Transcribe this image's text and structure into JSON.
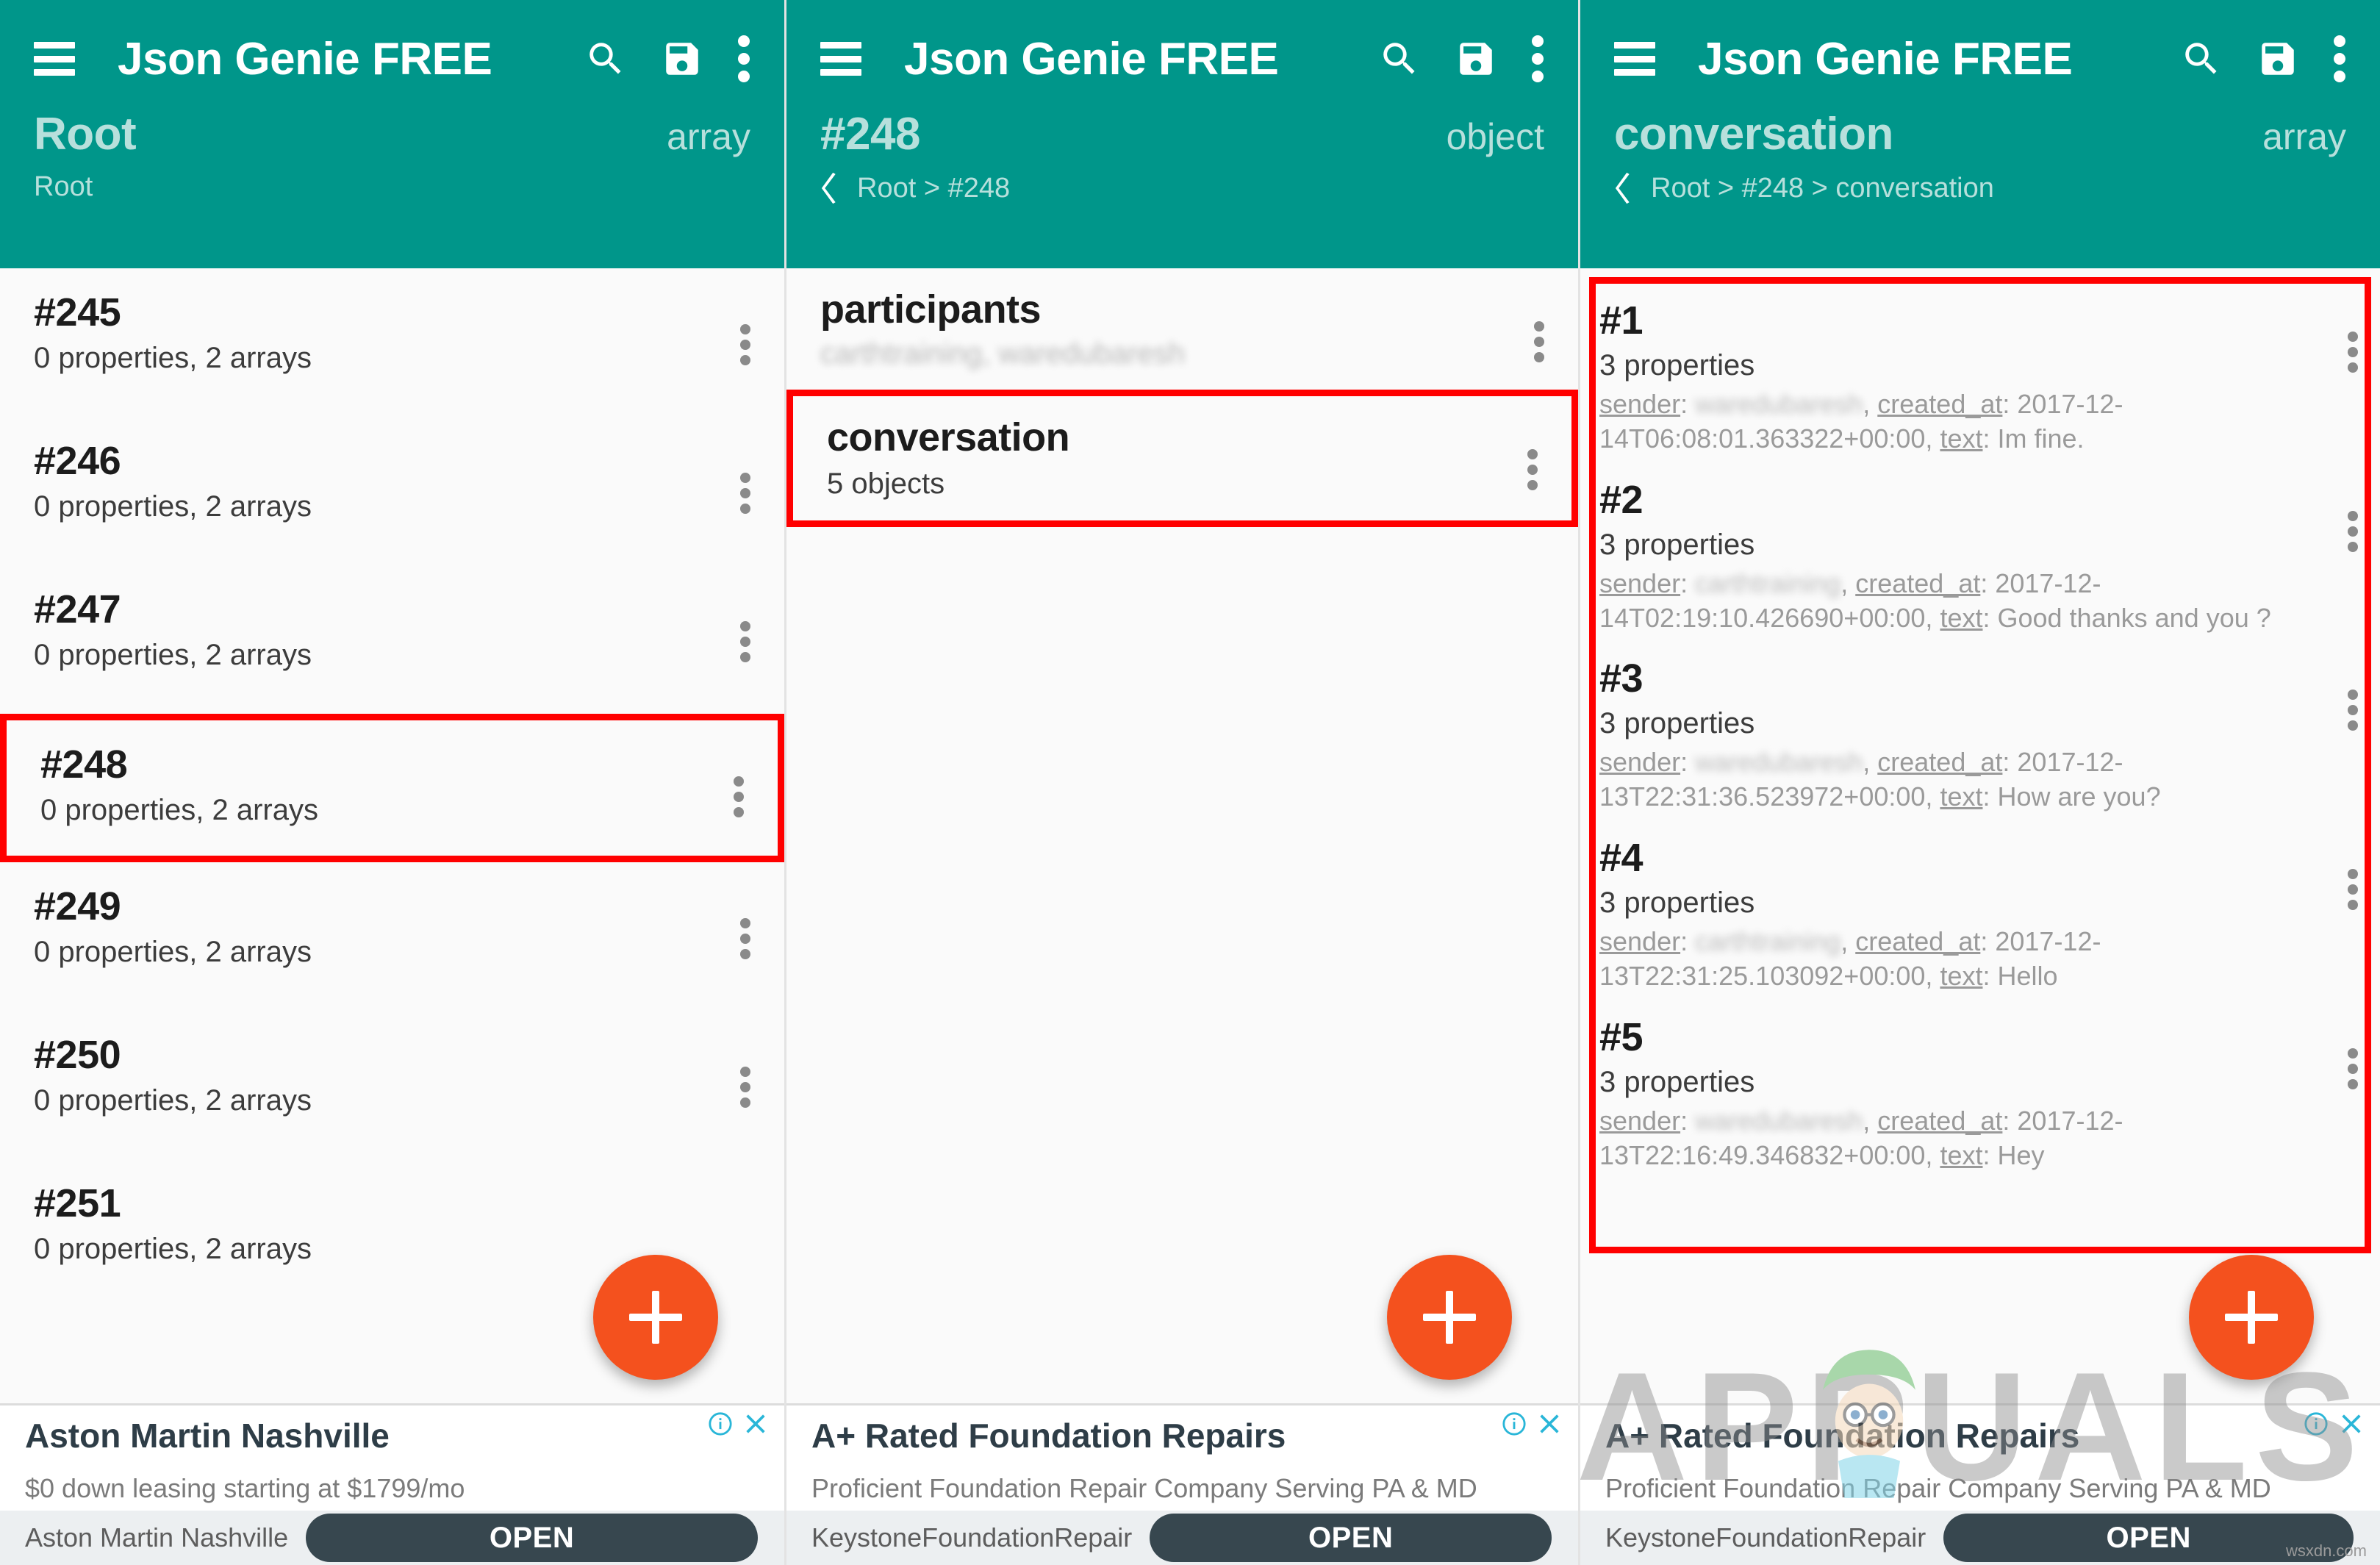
{
  "app": {
    "title": "Json Genie FREE",
    "theme_color": "#00968a",
    "fab_color": "#f4511e",
    "highlight_color": "#ff0000",
    "icons": {
      "menu": "hamburger-menu-icon",
      "search": "search-icon",
      "save": "save-icon",
      "overflow": "kebab-menu-icon",
      "back": "back-chevron-icon",
      "add": "add-plus-icon"
    }
  },
  "panels": [
    {
      "id": "root-panel",
      "header": {
        "node_name": "Root",
        "node_type": "array",
        "breadcrumb": "Root",
        "has_back": false
      },
      "rows": [
        {
          "title": "#245",
          "sub": "0 properties, 2 arrays",
          "highlighted": false
        },
        {
          "title": "#246",
          "sub": "0 properties, 2 arrays",
          "highlighted": false
        },
        {
          "title": "#247",
          "sub": "0 properties, 2 arrays",
          "highlighted": false
        },
        {
          "title": "#248",
          "sub": "0 properties, 2 arrays",
          "highlighted": true
        },
        {
          "title": "#249",
          "sub": "0 properties, 2 arrays",
          "highlighted": false
        },
        {
          "title": "#250",
          "sub": "0 properties, 2 arrays",
          "highlighted": false
        },
        {
          "title": "#251",
          "sub": "0 properties, 2 arrays",
          "highlighted": false
        }
      ],
      "ad": {
        "headline": "Aston Martin Nashville",
        "description": "$0 down leasing starting at $1799/mo",
        "advertiser": "Aston Martin Nashville",
        "cta": "OPEN"
      }
    },
    {
      "id": "node-248-panel",
      "header": {
        "node_name": "#248",
        "node_type": "object",
        "breadcrumb": "Root > #248",
        "has_back": true
      },
      "rows": [
        {
          "title": "participants",
          "sub": "",
          "sub_blurred": "carthtraining, waredubaresh",
          "highlighted": false
        },
        {
          "title": "conversation",
          "sub": "5 objects",
          "highlighted": true
        }
      ],
      "ad": {
        "headline": "A+ Rated Foundation Repairs",
        "description": "Proficient Foundation Repair Company Serving PA & MD",
        "advertiser": "KeystoneFoundationRepair",
        "cta": "OPEN"
      }
    },
    {
      "id": "conversation-panel",
      "header": {
        "node_name": "conversation",
        "node_type": "array",
        "breadcrumb": "Root > #248 > conversation",
        "has_back": true
      },
      "messages": [
        {
          "index": "#1",
          "properties": "3 properties",
          "sender_label": "sender",
          "sender_value": "waredubaresh",
          "created_label": "created_at",
          "created_value": "2017-12-14T06:08:01.363322+00:00",
          "text_label": "text",
          "text_value": "Im fine."
        },
        {
          "index": "#2",
          "properties": "3 properties",
          "sender_label": "sender",
          "sender_value": "carthtraining",
          "created_label": "created_at",
          "created_value": "2017-12-14T02:19:10.426690+00:00",
          "text_label": "text",
          "text_value": "Good thanks and you ?"
        },
        {
          "index": "#3",
          "properties": "3 properties",
          "sender_label": "sender",
          "sender_value": "waredubaresh",
          "created_label": "created_at",
          "created_value": "2017-12-13T22:31:36.523972+00:00",
          "text_label": "text",
          "text_value": "How are you?"
        },
        {
          "index": "#4",
          "properties": "3 properties",
          "sender_label": "sender",
          "sender_value": "carthtraining",
          "created_label": "created_at",
          "created_value": "2017-12-13T22:31:25.103092+00:00",
          "text_label": "text",
          "text_value": "Hello"
        },
        {
          "index": "#5",
          "properties": "3 properties",
          "sender_label": "sender",
          "sender_value": "waredubaresh",
          "created_label": "created_at",
          "created_value": "2017-12-13T22:16:49.346832+00:00",
          "text_label": "text",
          "text_value": "Hey"
        }
      ],
      "ad": {
        "headline": "A+ Rated Foundation Repairs",
        "description": "Proficient Foundation Repair Company Serving PA & MD",
        "advertiser": "KeystoneFoundationRepair",
        "cta": "OPEN"
      }
    }
  ],
  "watermark": {
    "text": "APPUALS",
    "credit": "wsxdn.com"
  }
}
